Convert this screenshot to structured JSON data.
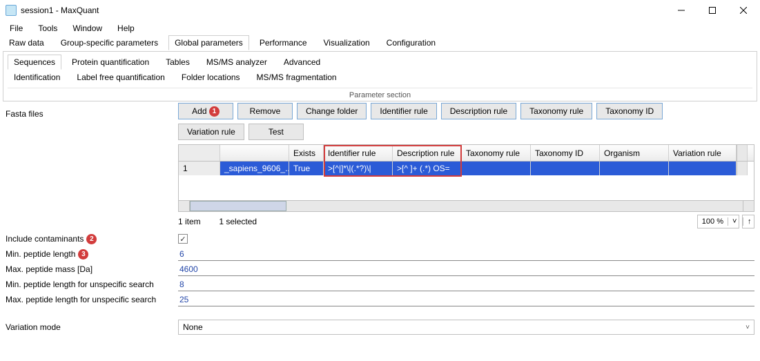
{
  "window": {
    "title": "session1 - MaxQuant"
  },
  "menu": {
    "file": "File",
    "tools": "Tools",
    "window": "Window",
    "help": "Help"
  },
  "tabs": {
    "raw": "Raw data",
    "group": "Group-specific parameters",
    "global": "Global parameters",
    "perf": "Performance",
    "viz": "Visualization",
    "config": "Configuration"
  },
  "subtabs": {
    "sequences": "Sequences",
    "protquant": "Protein quantification",
    "tables": "Tables",
    "msms": "MS/MS analyzer",
    "advanced": "Advanced",
    "ident": "Identification",
    "lfq": "Label free quantification",
    "folders": "Folder locations",
    "frag": "MS/MS fragmentation"
  },
  "param_section": "Parameter section",
  "labels": {
    "fasta": "Fasta files",
    "include_contaminants": "Include contaminants",
    "min_peptide_length": "Min. peptide length",
    "max_peptide_mass": "Max. peptide mass [Da]",
    "min_unspec": "Min. peptide length for unspecific search",
    "max_unspec": "Max. peptide length for unspecific search",
    "variation_mode": "Variation mode"
  },
  "buttons": {
    "add": "Add",
    "remove": "Remove",
    "change_folder": "Change folder",
    "identifier_rule": "Identifier rule",
    "description_rule": "Description rule",
    "taxonomy_rule": "Taxonomy rule",
    "taxonomy_id": "Taxonomy ID",
    "variation_rule": "Variation rule",
    "test": "Test"
  },
  "table": {
    "headers": {
      "exists": "Exists",
      "identifier_rule": "Identifier rule",
      "description_rule": "Description rule",
      "taxonomy_rule": "Taxonomy rule",
      "taxonomy_id": "Taxonomy ID",
      "organism": "Organism",
      "variation_rule": "Variation rule"
    },
    "rows": [
      {
        "index": "1",
        "file": "_sapiens_9606_...",
        "exists": "True",
        "identifier_rule": ">[^|]*\\|(.*?)\\|",
        "description_rule": ">[^ ]+ (.*) OS=",
        "taxonomy_rule": "",
        "taxonomy_id": "",
        "organism": "",
        "variation_rule": ""
      }
    ],
    "status_count": "1 item",
    "status_selected": "1 selected",
    "zoom": "100 %"
  },
  "fields": {
    "min_peptide_length": "6",
    "max_peptide_mass": "4600",
    "min_unspec": "8",
    "max_unspec": "25",
    "variation_mode": "None"
  },
  "markers": {
    "m1": "1",
    "m2": "2",
    "m3": "3"
  }
}
